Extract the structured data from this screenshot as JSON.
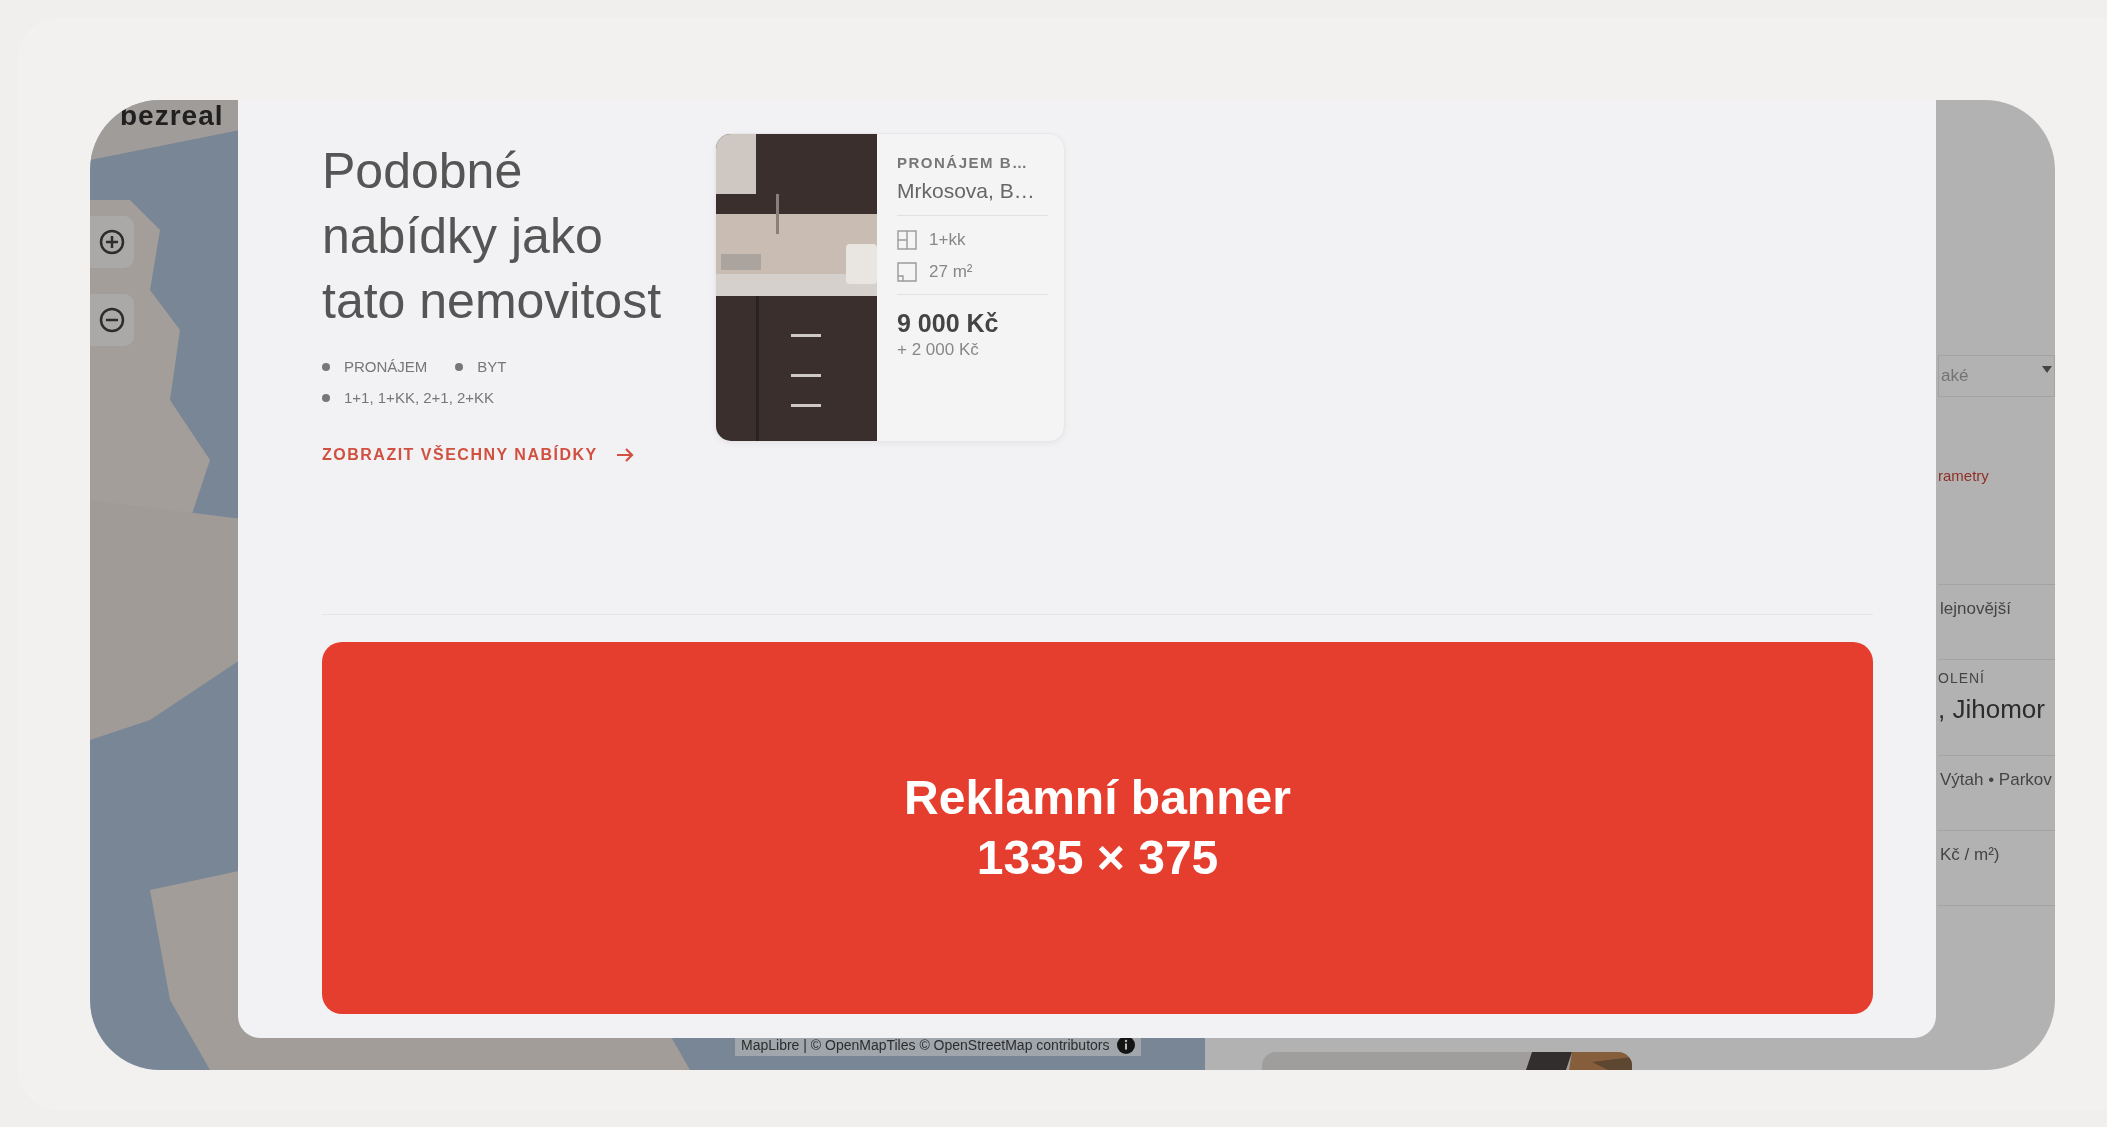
{
  "background": {
    "logo": "bezreal",
    "attribution": "MapLibre | © OpenMapTiles © OpenStreetMap contributors",
    "sidebar_fragments": [
      {
        "kind": "select",
        "text": "aké"
      },
      {
        "kind": "link",
        "text": "rametry"
      },
      {
        "kind": "text",
        "text": "lejnovější"
      },
      {
        "kind": "label",
        "text": "OLENÍ"
      },
      {
        "kind": "heading",
        "text": ", Jihomor"
      },
      {
        "kind": "text",
        "text": "Výtah • Parkov"
      },
      {
        "kind": "text",
        "text": "Kč / m²)"
      }
    ]
  },
  "modal": {
    "title": "Podobné nabídky jako tato nemovitost",
    "tags": [
      "PRONÁJEM",
      "BYT",
      "1+1, 1+KK, 2+1, 2+KK"
    ],
    "link": "ZOBRAZIT VŠECHNY NABÍDKY",
    "listing": {
      "type": "PRONÁJEM B…",
      "address": "Mrkosova, B…",
      "layout": "1+kk",
      "area": "27 m²",
      "price": "9 000 Kč",
      "fees": "+ 2 000 Kč"
    },
    "banner": {
      "title": "Reklamní banner",
      "size": "1335 × 375"
    }
  }
}
